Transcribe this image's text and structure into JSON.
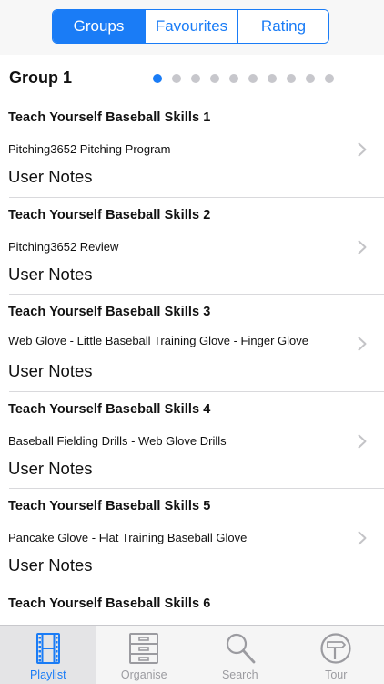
{
  "segments": [
    {
      "label": "Groups",
      "active": true
    },
    {
      "label": "Favourites",
      "active": false
    },
    {
      "label": "Rating",
      "active": false
    }
  ],
  "group": {
    "title": "Group 1",
    "page_count": 10,
    "current_page": 1
  },
  "rows": [
    {
      "title": "Teach Yourself Baseball Skills 1",
      "subtitle": "Pitching3652 Pitching Program",
      "notes": "User Notes"
    },
    {
      "title": "Teach Yourself Baseball Skills 2",
      "subtitle": "Pitching3652 Review",
      "notes": "User Notes"
    },
    {
      "title": "Teach Yourself Baseball Skills 3",
      "subtitle": "Web Glove - Little Baseball Training Glove - Finger Glove",
      "notes": "User Notes"
    },
    {
      "title": "Teach Yourself Baseball Skills 4",
      "subtitle": "Baseball Fielding Drills - Web Glove Drills",
      "notes": "User Notes"
    },
    {
      "title": "Teach Yourself Baseball Skills 5",
      "subtitle": "Pancake Glove - Flat Training Baseball Glove",
      "notes": "User Notes"
    },
    {
      "title": "Teach Yourself Baseball Skills 6",
      "subtitle": "",
      "notes": ""
    }
  ],
  "tabs": [
    {
      "label": "Playlist",
      "icon": "film-strip-icon",
      "active": true
    },
    {
      "label": "Organise",
      "icon": "cabinet-icon",
      "active": false
    },
    {
      "label": "Search",
      "icon": "magnifier-icon",
      "active": false
    },
    {
      "label": "Tour",
      "icon": "signpost-icon",
      "active": false
    }
  ],
  "colors": {
    "accent": "#1a7cf6",
    "inactive_tab": "#9b9ba0",
    "separator": "#d9d9dc"
  }
}
